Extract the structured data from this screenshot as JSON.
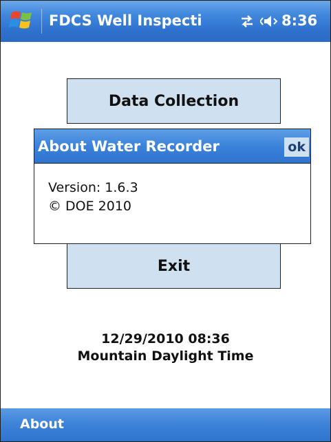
{
  "titlebar": {
    "start_icon": "windows-flag-icon",
    "title": "FDCS Well Inspecti",
    "connectivity_icon": "connectivity-arrows-icon",
    "volume_icon": "speaker-volume-icon",
    "clock": "8:36"
  },
  "main": {
    "data_collection_label": "Data Collection",
    "exit_label": "Exit"
  },
  "dialog": {
    "title": "About Water Recorder",
    "ok_label": "ok",
    "version": "Version: 1.6.3",
    "copyright": "© DOE 2010"
  },
  "datetime": {
    "date_time": "12/29/2010 08:36",
    "timezone": "Mountain Daylight Time"
  },
  "menubar": {
    "left_label": "About"
  },
  "colors": {
    "titlebar_blue": "#3f86dc",
    "button_fill": "#cfe0f1",
    "border": "#1e1e1e"
  }
}
